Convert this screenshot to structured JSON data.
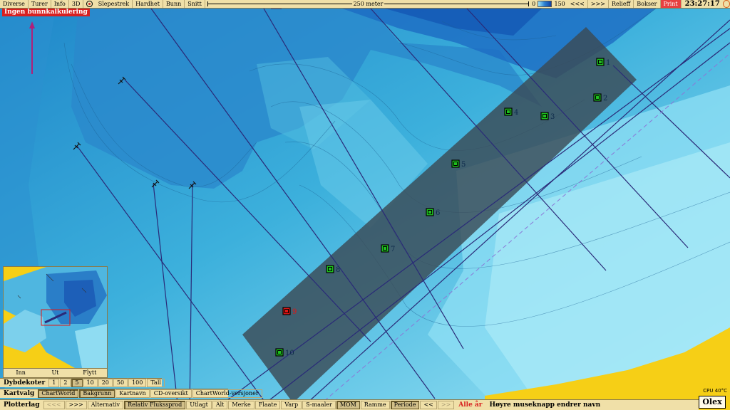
{
  "menu": {
    "items": [
      "Diverse",
      "Turer",
      "Info",
      "3D"
    ],
    "items2": [
      "Slepestrek",
      "Hardhet",
      "Bunn",
      "Snitt"
    ],
    "scale_label": "250 meter",
    "depth_min": "0",
    "depth_max": "150",
    "nav_left": "<<<",
    "nav_right": ">>>",
    "relief": "Relieff",
    "boxes": "Bokser",
    "print": "Print",
    "clock": "23:27:17"
  },
  "alert": "Ingen bunnkalkulering",
  "markers": [
    "1",
    "2",
    "3",
    "4",
    "5",
    "6",
    "7",
    "8",
    "9",
    "10"
  ],
  "minimap": {
    "buttons": [
      "Inn",
      "Ut",
      "Flytt"
    ]
  },
  "depth_contours": {
    "label": "Dybdekoter",
    "options": [
      "1",
      "2",
      "5",
      "10",
      "20",
      "50",
      "100",
      "Tall"
    ],
    "selected": "5"
  },
  "chart_select": {
    "label": "Kartvalg",
    "options": [
      "ChartWorld",
      "Bakgrunn",
      "Kartnavn",
      "CD-oversikt",
      "ChartWorld-versjoner"
    ],
    "selected": [
      "ChartWorld",
      "Bakgrunn"
    ]
  },
  "plotter": {
    "label": "Plotterlag",
    "prev": "<<<",
    "next": ">>>",
    "options": [
      "Alternativ",
      "Relativ Flukssprod",
      "Utlagt",
      "Alt",
      "Merke",
      "Flaate",
      "Varp",
      "S-maaler",
      "MOM",
      "Ramme",
      "Periode",
      "<<"
    ],
    "selected": [
      "Relativ Flukssprod",
      "MOM",
      "Periode"
    ],
    "year_label": "Alle år",
    "hint": "Høyre museknapp endrer navn"
  },
  "status": {
    "cpu": "CPU 40°C",
    "brand": "Olex"
  },
  "colors": {
    "sea_shallow": "#8ee0f3",
    "sea_mid": "#3fb5de",
    "sea_deep": "#1a6fc4",
    "land": "#f6cf16",
    "track": "#2a2a78",
    "marker_green": "#1ec01e",
    "marker_red": "#e01616"
  }
}
